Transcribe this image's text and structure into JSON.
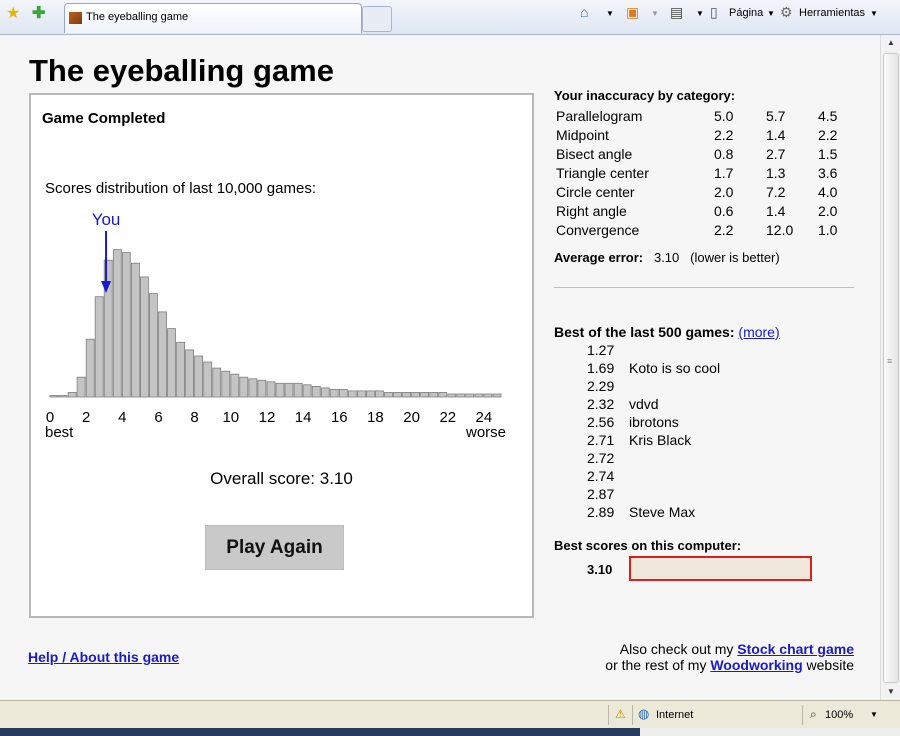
{
  "browser": {
    "tab_title": "The eyeballing game",
    "page_menu": "Página",
    "tools_menu": "Herramientas"
  },
  "page": {
    "title": "The eyeballing game",
    "help_link": "Help / About this game",
    "also_text1": "Also check out my",
    "stock_link": "Stock chart game",
    "also_text2": "or the rest of my",
    "wood_link": "Woodworking",
    "also_text3": "website"
  },
  "game": {
    "title": "Game Completed",
    "distribution_label": "Scores distribution of last 10,000 games:",
    "you_label": "You",
    "best_label": "best",
    "worse_label": "worse",
    "overall_label": "Overall score: 3.10",
    "play_again": "Play Again"
  },
  "chart_data": {
    "type": "bar",
    "title": "Scores distribution of last 10,000 games:",
    "x_ticks": [
      "0",
      "2",
      "4",
      "6",
      "8",
      "10",
      "12",
      "14",
      "16",
      "18",
      "20",
      "22",
      "24"
    ],
    "bin_width": 1,
    "x_start": 0,
    "xlim": [
      0,
      25
    ],
    "ylim": [
      0,
      100
    ],
    "values": [
      1,
      1,
      3,
      13,
      38,
      66,
      90,
      97,
      95,
      88,
      79,
      68,
      56,
      45,
      36,
      31,
      27,
      23,
      19,
      17,
      15,
      13,
      12,
      11,
      10,
      9,
      9,
      9,
      8,
      7,
      6,
      5,
      5,
      4,
      4,
      4,
      4,
      3,
      3,
      3,
      3,
      3,
      3,
      3,
      2,
      2,
      2,
      2,
      2,
      2
    ],
    "marker": {
      "label": "You",
      "x": 3.1
    },
    "color": "#c4c4c4",
    "outline": "#7f7f7f",
    "marker_color": "#1a1ac8"
  },
  "accuracy": {
    "title": "Your inaccuracy by category:",
    "rows": [
      {
        "name": "Parallelogram",
        "v1": "5.0",
        "v2": "5.7",
        "v3": "4.5"
      },
      {
        "name": "Midpoint",
        "v1": "2.2",
        "v2": "1.4",
        "v3": "2.2"
      },
      {
        "name": "Bisect angle",
        "v1": "0.8",
        "v2": "2.7",
        "v3": "1.5"
      },
      {
        "name": "Triangle center",
        "v1": "1.7",
        "v2": "1.3",
        "v3": "3.6"
      },
      {
        "name": "Circle center",
        "v1": "2.0",
        "v2": "7.2",
        "v3": "4.0"
      },
      {
        "name": "Right angle",
        "v1": "0.6",
        "v2": "1.4",
        "v3": "2.0"
      },
      {
        "name": "Convergence",
        "v1": "2.2",
        "v2": "12.0",
        "v3": "1.0"
      }
    ],
    "avg_label": "Average error:",
    "avg_value": "3.10",
    "avg_note": "(lower is better)"
  },
  "best": {
    "title": "Best of the last 500 games:",
    "more": "(more)",
    "rows": [
      {
        "score": "1.27",
        "name": ""
      },
      {
        "score": "1.69",
        "name": "Koto is so cool"
      },
      {
        "score": "2.29",
        "name": ""
      },
      {
        "score": "2.32",
        "name": "vdvd"
      },
      {
        "score": "2.56",
        "name": "ibrotons"
      },
      {
        "score": "2.71",
        "name": "Kris Black"
      },
      {
        "score": "2.72",
        "name": ""
      },
      {
        "score": "2.74",
        "name": ""
      },
      {
        "score": "2.87",
        "name": ""
      },
      {
        "score": "2.89",
        "name": "Steve Max"
      }
    ],
    "computer_title": "Best scores on this computer:",
    "computer_score": "3.10",
    "name_input_value": ""
  },
  "status": {
    "zone": "Internet",
    "zoom": "100%"
  }
}
